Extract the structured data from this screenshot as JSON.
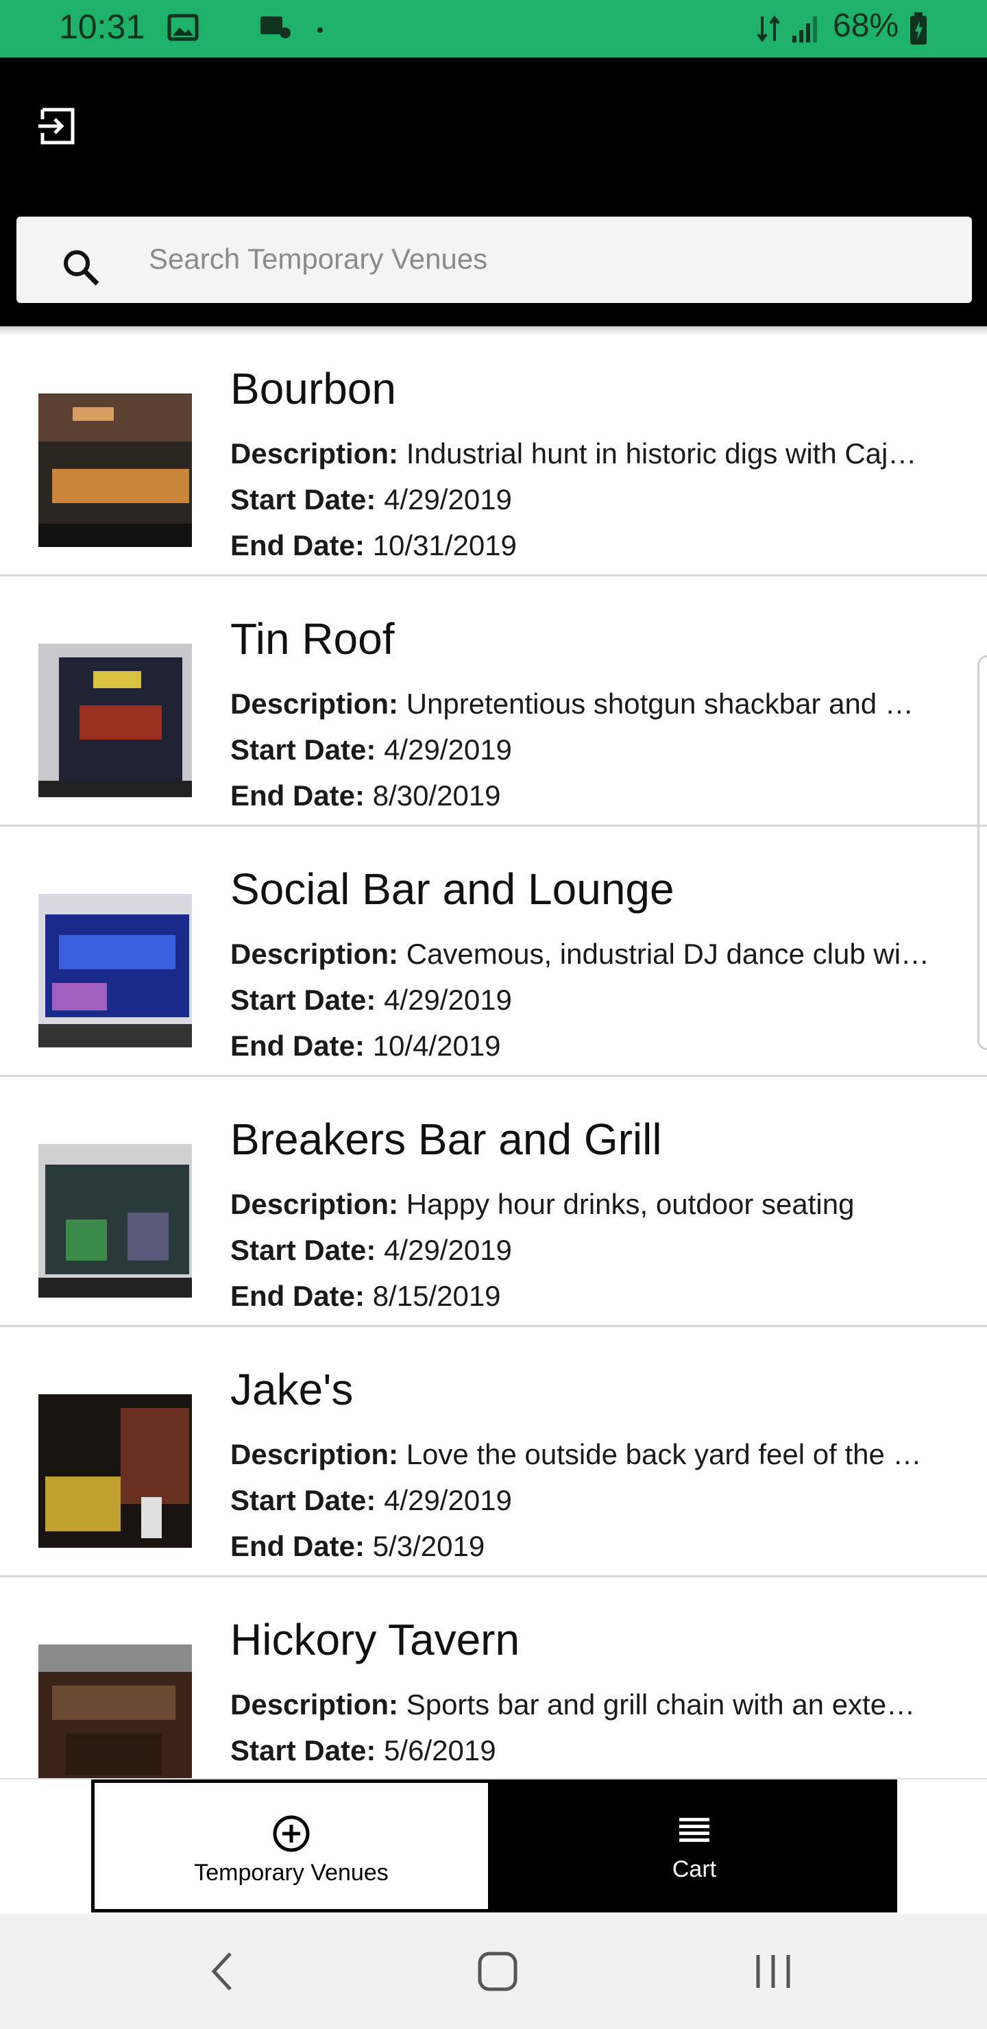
{
  "status_bar": {
    "time": "10:31",
    "battery": "68%",
    "icons": [
      "image-icon",
      "call-icon",
      "dot-icon",
      "data-icon",
      "signal-icon",
      "battery-icon"
    ]
  },
  "header": {
    "logout_icon": "logout-icon",
    "search": {
      "placeholder": "Search Temporary Venues",
      "value": ""
    }
  },
  "labels": {
    "description": "Description:",
    "start_date": "Start Date:",
    "end_date": "End Date:"
  },
  "venues": [
    {
      "name": "Bourbon",
      "description": "Industrial hunt in historic digs with Caj…",
      "start_date": "4/29/2019",
      "end_date": "10/31/2019"
    },
    {
      "name": "Tin Roof",
      "description": "Unpretentious shotgun shackbar and …",
      "start_date": "4/29/2019",
      "end_date": "8/30/2019"
    },
    {
      "name": "Social Bar and Lounge",
      "description": "Cavemous, industrial DJ dance club wi…",
      "start_date": "4/29/2019",
      "end_date": "10/4/2019"
    },
    {
      "name": "Breakers Bar and Grill",
      "description": "Happy hour drinks, outdoor seating",
      "start_date": "4/29/2019",
      "end_date": "8/15/2019"
    },
    {
      "name": "Jake's",
      "description": "Love the outside back yard feel of the …",
      "start_date": "4/29/2019",
      "end_date": "5/3/2019"
    },
    {
      "name": "Hickory Tavern",
      "description": "Sports bar and grill chain with an exte…",
      "start_date": "5/6/2019"
    }
  ],
  "bottom_nav": {
    "tabs": [
      {
        "label": "Temporary Venues",
        "icon": "add-circle-icon",
        "selected": true
      },
      {
        "label": "Cart",
        "icon": "list-icon",
        "selected": false
      }
    ]
  },
  "system_nav": {
    "icons": [
      "back-icon",
      "home-icon",
      "recents-icon"
    ]
  },
  "colors": {
    "status_bar": "#1db16a",
    "header": "#000000",
    "tab_selected_bg": "#ffffff",
    "tab_unselected_bg": "#000000"
  }
}
